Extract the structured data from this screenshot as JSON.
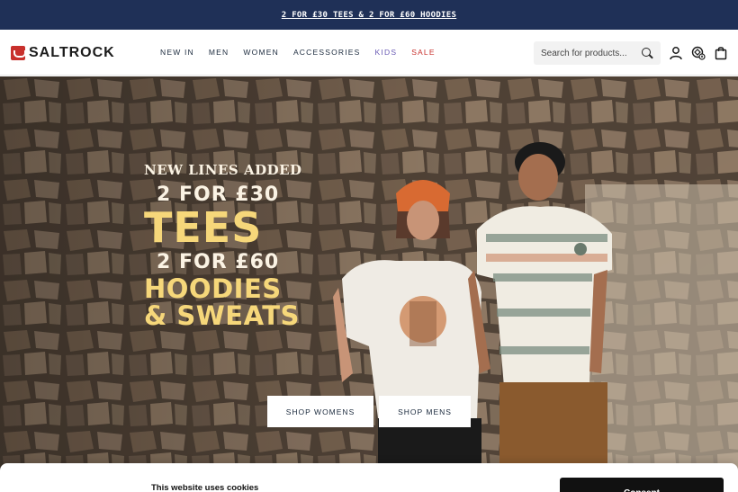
{
  "promo": {
    "text": "2 FOR £30 TEES & 2 FOR £60 HOODIES"
  },
  "header": {
    "logo_text": "SALTROCK",
    "nav": [
      {
        "label": "NEW IN"
      },
      {
        "label": "MEN"
      },
      {
        "label": "WOMEN"
      },
      {
        "label": "ACCESSORIES"
      },
      {
        "label": "KIDS"
      },
      {
        "label": "SALE"
      }
    ],
    "search_placeholder": "Search for products...",
    "icons": [
      "account-icon",
      "store-locator-icon",
      "bag-icon"
    ]
  },
  "hero": {
    "line1": "NEW LINES ADDED",
    "line2": "2 FOR £30",
    "line3": "TEES",
    "line4": "2 FOR £60",
    "line5": "HOODIES",
    "line6": "& SWEATS",
    "shop_women": "SHOP WOMENS",
    "shop_men": "SHOP MENS"
  },
  "cookie": {
    "title": "This website uses cookies",
    "consent_button": "Consent"
  },
  "colors": {
    "promo_bg": "#1f3057",
    "kids": "#6a5bb5",
    "sale": "#c8302c",
    "headline_accent": "#f6d77a"
  }
}
